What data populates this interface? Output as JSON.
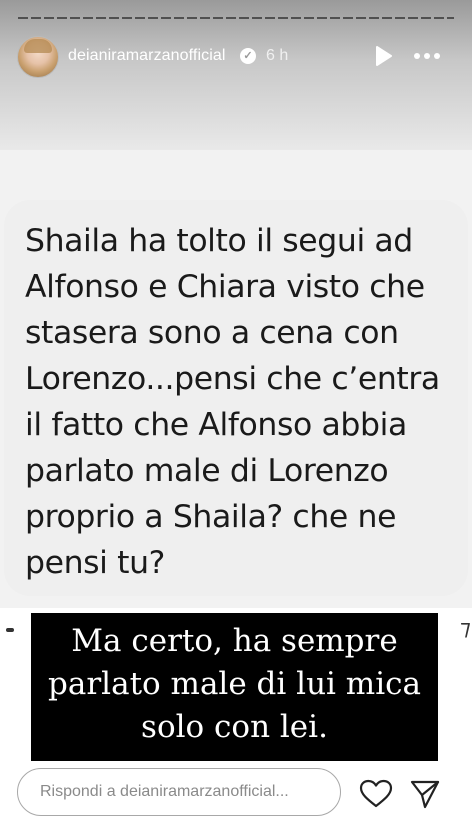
{
  "header": {
    "username": "deianiramarzanofficial",
    "time": "6 h",
    "verified_glyph": "✓",
    "icons": {
      "avatar": "profile-avatar",
      "verified": "verified-badge-icon",
      "play": "play-icon",
      "more": "more-options-icon"
    }
  },
  "question": {
    "text": "Shaila ha tolto il segui ad Alfonso e Chiara visto che stasera sono a cena con Lorenzo...pensi che c’entra il fatto che Alfonso abbia parlato male di Lorenzo proprio a Shaila? che ne pensi tu?"
  },
  "answer": {
    "lines": [
      "Ma certo, ha sempre",
      "parlato male di lui mica",
      "solo con lei."
    ]
  },
  "footer": {
    "reply_placeholder": "Rispondi a deianiramarzanofficial...",
    "icons": {
      "like": "heart-icon",
      "share": "send-icon"
    }
  },
  "colors": {
    "answer_background": "#000000",
    "answer_text": "#ffffff",
    "question_bubble": "#efefef"
  }
}
